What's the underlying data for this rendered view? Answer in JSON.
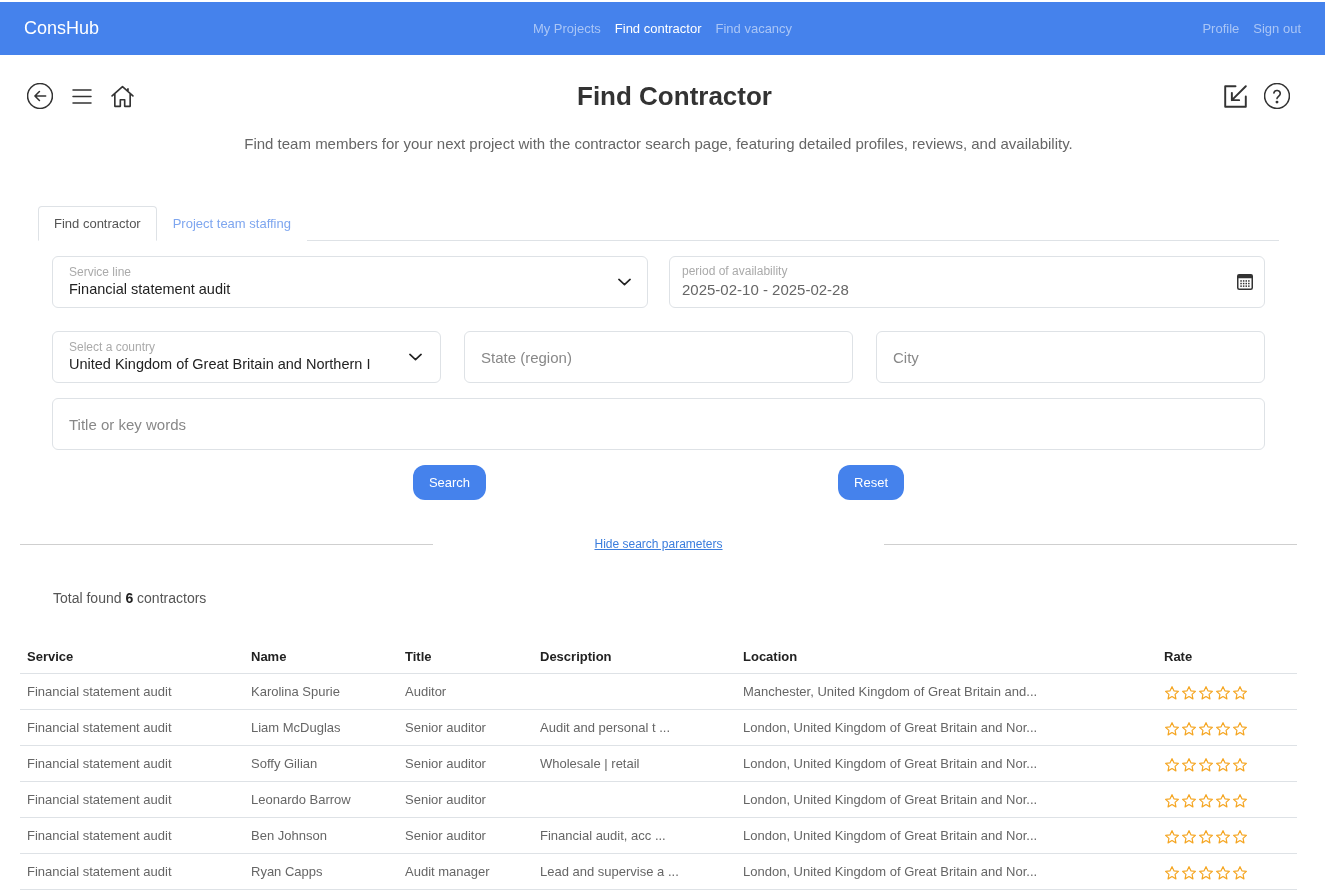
{
  "nav": {
    "logo": "ConsHub",
    "links": [
      {
        "label": "My Projects",
        "selected": false
      },
      {
        "label": "Find contractor",
        "selected": true
      },
      {
        "label": "Find vacancy",
        "selected": false
      }
    ],
    "account_links": [
      "Profile",
      "Sign out"
    ]
  },
  "header": {
    "title": "Find Contractor",
    "subtitle": "Find team members for your next project with the contractor search page, featuring detailed profiles, reviews, and availability."
  },
  "tabs": [
    {
      "label": "Find contractor",
      "selected": true
    },
    {
      "label": "Project team staffing",
      "selected": false
    }
  ],
  "form": {
    "service_line": {
      "label": "Service line",
      "value": "Financial statement audit"
    },
    "availability": {
      "label": "period of availability",
      "value": "2025-02-10 - 2025-02-28"
    },
    "country": {
      "label": "Select a country",
      "value": "United Kingdom of Great Britain and Northern I"
    },
    "state": {
      "placeholder": "State (region)"
    },
    "city": {
      "placeholder": "City"
    },
    "keywords": {
      "placeholder": "Title or key words"
    },
    "buttons": [
      "Search",
      "Reset"
    ]
  },
  "toggle_link": "Hide search parameters",
  "results": {
    "summary": "Total found **6** contractors"
  },
  "table": {
    "columns": [
      "Service",
      "Name",
      "Title",
      "Description",
      "Location",
      "Rate"
    ],
    "rows": [
      {
        "service": "Financial statement audit",
        "name": "Karolina Spurie",
        "title": "Auditor",
        "location": "Manchester, United Kingdom of Great Britain and...",
        "stars": 0
      },
      {
        "service": "Financial statement audit",
        "name": "Liam McDuglas",
        "title": "Senior auditor",
        "description": "Audit and personal t ...",
        "location": "London, United Kingdom of Great Britain and Nor...",
        "stars": 0
      },
      {
        "service": "Financial statement audit",
        "name": "Soffy Gilian",
        "title": "Senior auditor",
        "description": "Wholesale | retail",
        "location": "London, United Kingdom of Great Britain and Nor...",
        "stars": 0
      },
      {
        "service": "Financial statement audit",
        "name": "Leonardo Barrow",
        "title": "Senior auditor",
        "location": "London, United Kingdom of Great Britain and Nor...",
        "stars": 0
      },
      {
        "service": "Financial statement audit",
        "name": "Ben Johnson",
        "title": "Senior auditor",
        "description": "Financial audit, acc ...",
        "location": "London, United Kingdom of Great Britain and Nor...",
        "stars": 0
      },
      {
        "service": "Financial statement audit",
        "name": "Ryan Capps",
        "title": "Audit manager",
        "description": "Lead and supervise a ...",
        "location": "London, United Kingdom of Great Britain and Nor...",
        "stars": 0
      }
    ]
  }
}
